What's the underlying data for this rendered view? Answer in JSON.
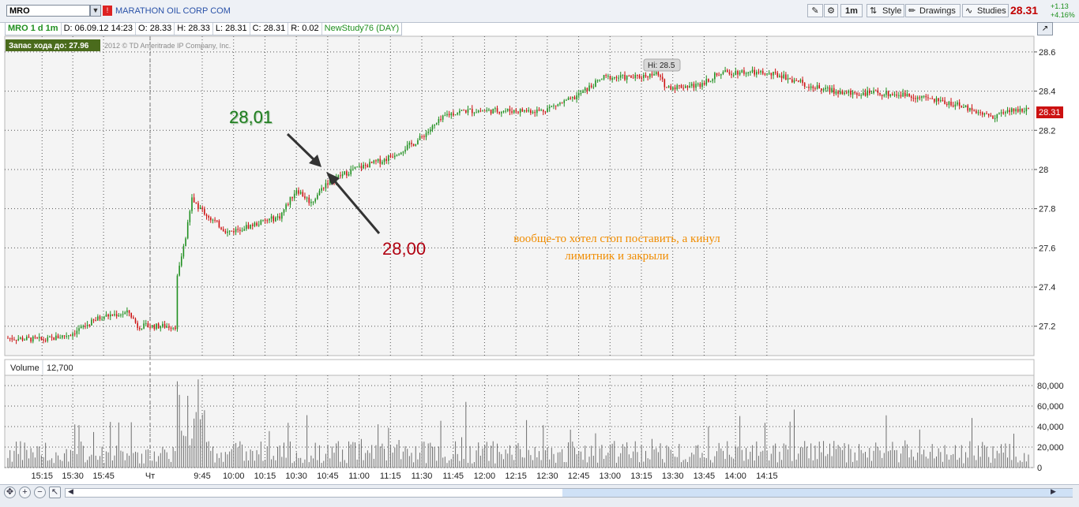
{
  "toolbar": {
    "symbol": "MRO",
    "company": "MARATHON OIL CORP COM",
    "aggregation": "1m",
    "style_label": "Style",
    "drawings_label": "Drawings",
    "studies_label": "Studies",
    "last_price": "28.31",
    "change": "+1.13",
    "change_pct": "+4.16%"
  },
  "info_bar": {
    "symbol_period": "MRO 1 d 1m",
    "date": "D: 06.09.12 14:23",
    "open": "O: 28.33",
    "high": "H: 28.33",
    "low": "L: 28.31",
    "close": "C: 28.31",
    "range": "R: 0.02",
    "study": "NewStudy76 (DAY)"
  },
  "overlay": {
    "reserve_label": "Запас хода до: 27.96",
    "copyright": "2012 © TD Ameritrade IP Company, Inc.",
    "hi_label": "Hi: 28.5",
    "price_tag": "28.31"
  },
  "annotations": {
    "top_value": "28,01",
    "bottom_value": "28,00",
    "comment_line1": "вообще-то хотел стоп поставить, а кинул",
    "comment_line2": "лимитник и закрыли"
  },
  "volume_panel": {
    "label": "Volume",
    "value": "12,700"
  },
  "colors": {
    "up": "#1f8f1f",
    "down": "#cc1111",
    "annotation_green": "#1e7d1e",
    "annotation_red": "#b00010",
    "comment": "#f08c00"
  },
  "chart_data": [
    {
      "type": "candlestick",
      "interval": "1m",
      "ylim": [
        27.05,
        28.68
      ],
      "y_ticks": [
        "28.6",
        "28.4",
        "28.2",
        "28",
        "27.8",
        "27.6",
        "27.4",
        "27.2"
      ],
      "x_ticks": [
        "15:15",
        "15:30",
        "15:45",
        "Чт",
        "9:45",
        "10:00",
        "10:15",
        "10:30",
        "10:45",
        "11:00",
        "11:15",
        "11:30",
        "11:45",
        "12:00",
        "12:15",
        "12:30",
        "12:45",
        "13:00",
        "13:15",
        "13:30",
        "13:45",
        "14:00",
        "14:15"
      ],
      "session_break": "Чт",
      "anchors": [
        [
          0,
          27.14
        ],
        [
          18,
          27.13
        ],
        [
          30,
          27.16
        ],
        [
          45,
          27.25
        ],
        [
          58,
          27.27
        ],
        [
          62,
          27.2
        ],
        [
          75,
          27.2
        ],
        [
          80,
          27.2
        ],
        [
          81,
          27.45
        ],
        [
          85,
          27.65
        ],
        [
          88,
          27.85
        ],
        [
          92,
          27.8
        ],
        [
          97,
          27.75
        ],
        [
          105,
          27.68
        ],
        [
          118,
          27.72
        ],
        [
          130,
          27.76
        ],
        [
          138,
          27.9
        ],
        [
          145,
          27.83
        ],
        [
          152,
          27.93
        ],
        [
          165,
          28.0
        ],
        [
          180,
          28.05
        ],
        [
          195,
          28.14
        ],
        [
          210,
          28.28
        ],
        [
          218,
          28.3
        ],
        [
          233,
          28.3
        ],
        [
          255,
          28.3
        ],
        [
          270,
          28.36
        ],
        [
          285,
          28.47
        ],
        [
          300,
          28.47
        ],
        [
          310,
          28.49
        ],
        [
          315,
          28.42
        ],
        [
          330,
          28.43
        ],
        [
          340,
          28.49
        ],
        [
          350,
          28.5
        ],
        [
          370,
          28.48
        ],
        [
          385,
          28.42
        ],
        [
          400,
          28.39
        ],
        [
          415,
          28.39
        ],
        [
          430,
          28.38
        ],
        [
          440,
          28.36
        ],
        [
          450,
          28.34
        ],
        [
          460,
          28.31
        ],
        [
          470,
          28.27
        ],
        [
          480,
          28.3
        ],
        [
          488,
          28.31
        ]
      ],
      "last": 28.31,
      "high": 28.5
    },
    {
      "type": "bar",
      "series_label": "Volume",
      "ylim": [
        0,
        90000
      ],
      "y_ticks": [
        "80,000",
        "60,000",
        "40,000",
        "20,000",
        "0"
      ],
      "current_value": "12,700"
    }
  ]
}
